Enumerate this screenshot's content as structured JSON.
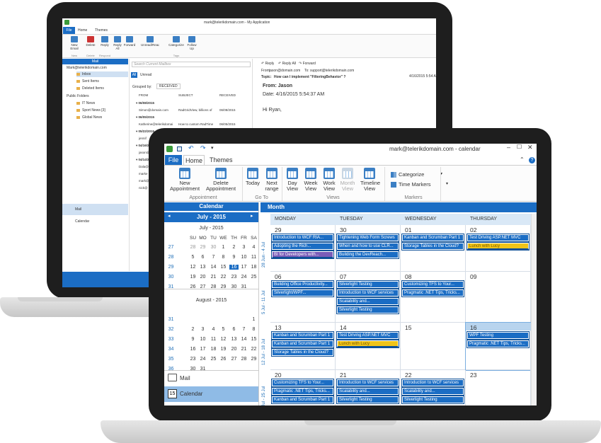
{
  "back": {
    "title": "mark@telerikdomain.com - My Application",
    "tabs": [
      "File",
      "Home",
      "Themes"
    ],
    "ribbon": [
      {
        "label": "New\nEmail",
        "group": "New"
      },
      {
        "label": "Delete",
        "group": "Delete"
      },
      {
        "label": "Reply",
        "group": "Respond"
      },
      {
        "label": "Reply\nAll",
        "group": ""
      },
      {
        "label": "Forward",
        "group": ""
      },
      {
        "label": "Unread/Read",
        "group": ""
      },
      {
        "label": "Categorize",
        "group": "Tags"
      },
      {
        "label": "Follow\nUp",
        "group": ""
      }
    ],
    "nav_header": "Mail",
    "account": "Mark@telerikdomain.com",
    "folders": [
      "Inbox",
      "Sent Items",
      "Deleted Items"
    ],
    "public_folders": "Public Folders",
    "public_items": [
      "IT News",
      "Sport News [3]",
      "Global News"
    ],
    "bottom_nav": [
      "Mail",
      "Calendar"
    ],
    "search_placeholder": "Search Current Mailbox",
    "filter": [
      "All",
      "Unread"
    ],
    "grouped_by": "Grouped by:",
    "grouped_value": "RECEIVED",
    "columns": [
      "FROM",
      "SUBJECT",
      "RECEIVED"
    ],
    "groups": [
      {
        "date": "06/08/2015",
        "rows": [
          [
            "Simon@domain.com",
            "RadGridView, billions of",
            "06/08/2015"
          ]
        ]
      },
      {
        "date": "06/05/2015",
        "rows": [
          [
            "Katherine@telerikdomai",
            "How to custom RadTime",
            "06/05/2015"
          ]
        ]
      },
      {
        "date": "05/22/2015",
        "rows": [
          [
            "jennif",
            ""
          ]
        ]
      },
      {
        "date": "04/16/2015",
        "rows": [
          [
            "jason@",
            ""
          ]
        ]
      },
      {
        "date": "04/14/2015",
        "rows": [
          [
            "Dala@",
            ""
          ]
        ]
      },
      {
        "date": "",
        "rows": [
          [
            "marke",
            ""
          ],
          [
            "mark@",
            ""
          ],
          [
            "nick@",
            ""
          ]
        ]
      }
    ],
    "reading": {
      "reply": "Reply",
      "reply_all": "Reply All",
      "forward": "Forward",
      "from_label": "From:",
      "from": "jason@domain.com",
      "to_label": "To:",
      "to": "support@telerikdomain.com",
      "date_short": "4/16/2015 5:54 AM",
      "topic_label": "Topic:",
      "topic": "How can I implement \"FilteringBehavior\" ?",
      "from_line": "From: Jason",
      "date_line": "Date: 4/16/2015 5:54:37 AM",
      "greeting": "Hi Ryan,"
    }
  },
  "front": {
    "title": "mark@telerikdomain.com - calendar",
    "tabs": [
      "File",
      "Home",
      "Themes"
    ],
    "ribbon_buttons": [
      {
        "label": "New\nAppointment",
        "disabled": false
      },
      {
        "label": "Delete\nAppointment",
        "disabled": false
      },
      {
        "label": "Today",
        "disabled": false
      },
      {
        "label": "Next\nrange",
        "disabled": false
      },
      {
        "label": "Day\nView",
        "disabled": false
      },
      {
        "label": "Week\nView",
        "disabled": false
      },
      {
        "label": "Work\nView",
        "disabled": false
      },
      {
        "label": "Month\nView",
        "disabled": true
      },
      {
        "label": "Timeline\nView",
        "disabled": false
      }
    ],
    "ribbon_groups": [
      "Appointment",
      "Go To",
      "Views",
      "Markers"
    ],
    "markers": [
      "Categorize",
      "Time Markers"
    ],
    "calendar_header": "Calendar",
    "nav_month": "July - 2015",
    "cal1": {
      "title": "July - 2015",
      "days": [
        "SU",
        "MO",
        "TU",
        "WE",
        "TH",
        "FR",
        "SA"
      ],
      "weeks": [
        {
          "w": "27",
          "d": [
            "28",
            "29",
            "30",
            "1",
            "2",
            "3",
            "4"
          ]
        },
        {
          "w": "28",
          "d": [
            "5",
            "6",
            "7",
            "8",
            "9",
            "10",
            "11"
          ]
        },
        {
          "w": "29",
          "d": [
            "12",
            "13",
            "14",
            "15",
            "16",
            "17",
            "18"
          ]
        },
        {
          "w": "30",
          "d": [
            "19",
            "20",
            "21",
            "22",
            "23",
            "24",
            "25"
          ]
        },
        {
          "w": "31",
          "d": [
            "26",
            "27",
            "28",
            "29",
            "30",
            "31",
            ""
          ]
        }
      ],
      "today": "16"
    },
    "cal2": {
      "title": "August - 2015",
      "weeks": [
        {
          "w": "31",
          "d": [
            "",
            "",
            "",
            "",
            "",
            "",
            "1"
          ]
        },
        {
          "w": "32",
          "d": [
            "2",
            "3",
            "4",
            "5",
            "6",
            "7",
            "8"
          ]
        },
        {
          "w": "33",
          "d": [
            "9",
            "10",
            "11",
            "12",
            "13",
            "14",
            "15"
          ]
        },
        {
          "w": "34",
          "d": [
            "16",
            "17",
            "18",
            "19",
            "20",
            "21",
            "22"
          ]
        },
        {
          "w": "35",
          "d": [
            "23",
            "24",
            "25",
            "26",
            "27",
            "28",
            "29"
          ]
        },
        {
          "w": "36",
          "d": [
            "30",
            "31",
            "",
            "",
            "",
            "",
            ""
          ]
        }
      ]
    },
    "bottom_nav": [
      "Mail",
      "Calendar"
    ],
    "view_title": "Month",
    "weekdays": [
      "MONDAY",
      "TUESDAY",
      "WEDNESDAY",
      "THURSDAY"
    ],
    "week_labels": [
      "28 Jun - 4 Jul",
      "5 Jul - 11 Jul",
      "12 Jul - 18 Jul",
      "19 Jul - 25 Jul"
    ],
    "weeks": [
      {
        "days": [
          {
            "n": "29",
            "ev": [
              {
                "t": "Introduction to WCF RIA...",
                "c": "b"
              },
              {
                "t": "Adopting the Rich...",
                "c": "b"
              },
              {
                "t": "BI for Developers with...",
                "c": "p"
              }
            ]
          },
          {
            "n": "30",
            "ev": [
              {
                "t": "Tightening Web Form Screws",
                "c": "b"
              },
              {
                "t": "When and how to use CLR...",
                "c": "b"
              },
              {
                "t": "Building the DevReach...",
                "c": "b"
              }
            ]
          },
          {
            "n": "01",
            "ev": [
              {
                "t": "Kanban and Scrumban Part 1",
                "c": "b"
              },
              {
                "t": "Storage Tables in the Cloud?",
                "c": "b"
              }
            ]
          },
          {
            "n": "02",
            "ev": [
              {
                "t": "Test Driving ASP.NET MVC",
                "c": "b"
              },
              {
                "t": "Lunch with Lucy",
                "c": "y"
              }
            ]
          }
        ]
      },
      {
        "days": [
          {
            "n": "06",
            "ev": [
              {
                "t": "Building Office Productivity...",
                "c": "b"
              },
              {
                "t": "Silverlight/WPF...",
                "c": "b"
              }
            ]
          },
          {
            "n": "07",
            "ev": [
              {
                "t": "Silverlight Testing",
                "c": "b"
              },
              {
                "t": "Introduction to WCF services",
                "c": "b"
              },
              {
                "t": "Scalability and...",
                "c": "b"
              },
              {
                "t": "Silverlight Testing",
                "c": "b"
              }
            ]
          },
          {
            "n": "08",
            "ev": [
              {
                "t": "Customizing TFS to Your...",
                "c": "b"
              },
              {
                "t": "Pragmatic .NET Tips, Tricks...",
                "c": "b"
              }
            ]
          },
          {
            "n": "09",
            "ev": []
          }
        ]
      },
      {
        "days": [
          {
            "n": "13",
            "ev": [
              {
                "t": "Kanban and Scrumban Part 1",
                "c": "b"
              },
              {
                "t": "Kanban and Scrumban Part 1",
                "c": "b"
              },
              {
                "t": "Storage Tables in the Cloud?",
                "c": "b"
              }
            ]
          },
          {
            "n": "14",
            "ev": [
              {
                "t": "Test Driving ASP.NET MVC",
                "c": "b"
              },
              {
                "t": "Lunch with Lucy",
                "c": "y"
              }
            ]
          },
          {
            "n": "15",
            "ev": []
          },
          {
            "n": "16",
            "ev": [
              {
                "t": "WPF Testing",
                "c": "b"
              },
              {
                "t": "Pragmatic .NET Tips, Tricks...",
                "c": "b"
              }
            ]
          }
        ]
      },
      {
        "days": [
          {
            "n": "20",
            "ev": [
              {
                "t": "Customizing TFS to Your...",
                "c": "b"
              },
              {
                "t": "Pragmatic .NET Tips, Tricks...",
                "c": "b"
              },
              {
                "t": "Kanban and Scrumban Part 1",
                "c": "b"
              }
            ]
          },
          {
            "n": "21",
            "ev": [
              {
                "t": "Introduction to WCF services",
                "c": "b"
              },
              {
                "t": "Scalability and...",
                "c": "b"
              },
              {
                "t": "Silverlight Testing",
                "c": "b"
              }
            ]
          },
          {
            "n": "22",
            "ev": [
              {
                "t": "Introduction to WCF services",
                "c": "b"
              },
              {
                "t": "Scalability and...",
                "c": "b"
              },
              {
                "t": "Silverlight Testing",
                "c": "b"
              }
            ]
          },
          {
            "n": "23",
            "ev": []
          }
        ]
      }
    ]
  }
}
